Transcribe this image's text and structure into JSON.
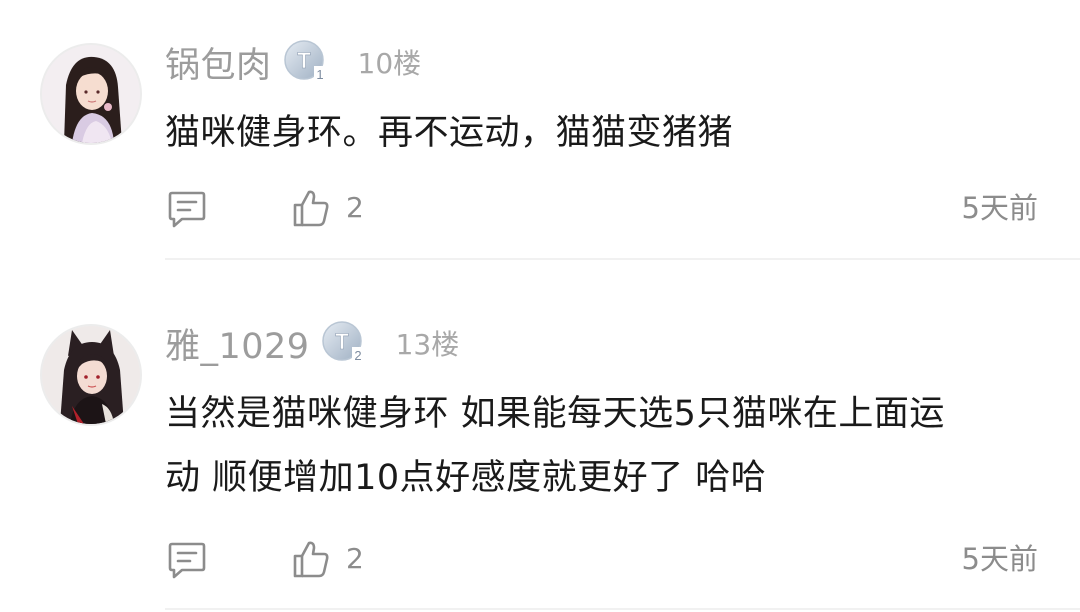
{
  "comments": [
    {
      "username": "锅包肉",
      "level": "1",
      "floor": "10楼",
      "content": "猫咪健身环。再不运动，猫猫变猪猪",
      "like_count": "2",
      "time": "5天前",
      "avatar": "girl-black-hair-avatar"
    },
    {
      "username": "雅_1029",
      "level": "2",
      "floor": "13楼",
      "content_line1": "当然是猫咪健身环 如果能每天选5只猫咪在上面运",
      "content_line2": "动 顺便增加10点好感度就更好了 哈哈",
      "like_count": "2",
      "time": "5天前",
      "avatar": "fox-girl-avatar"
    }
  ],
  "colors": {
    "text": "#1a1a1a",
    "meta": "#9c9c9c",
    "icon": "#8c8c8c",
    "divider": "#f1f1f1",
    "badge": "#aab8c8"
  },
  "icons": {
    "reply": "chat-bubble-icon",
    "like": "thumbs-up-icon",
    "level_badge": "silver-t-badge-icon"
  }
}
